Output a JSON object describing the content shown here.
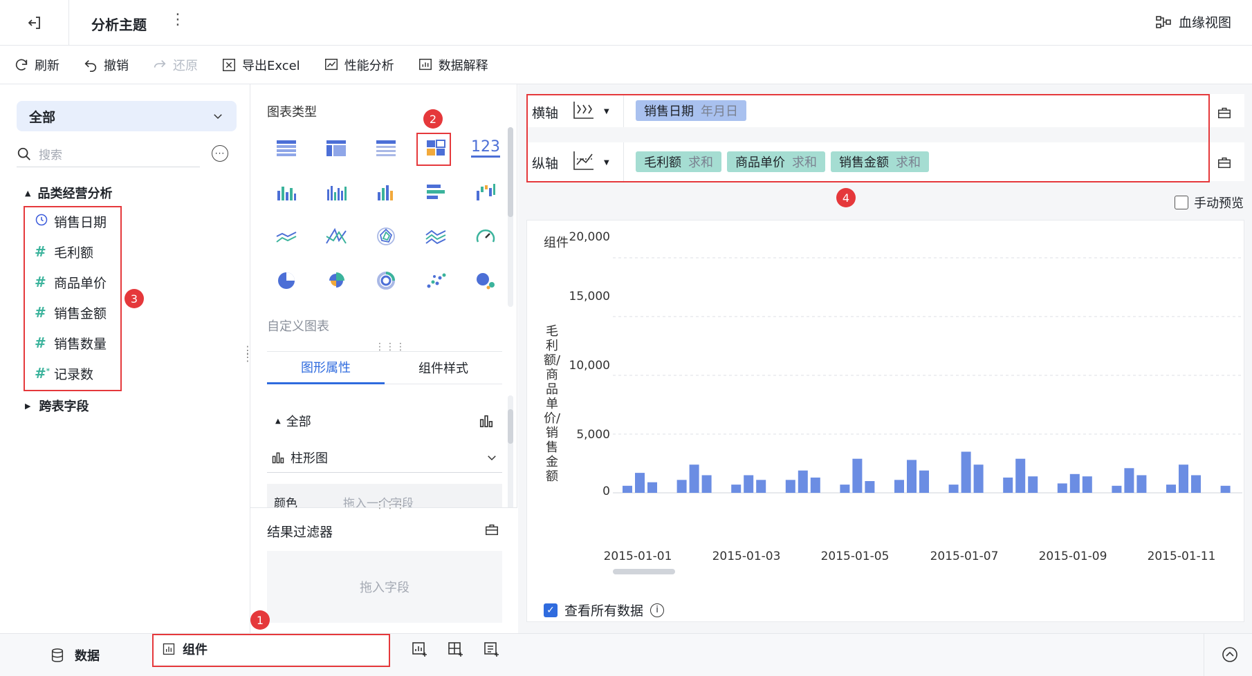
{
  "header": {
    "title": "分析主题",
    "lineage_label": "血缘视图"
  },
  "toolbar": {
    "refresh": "刷新",
    "undo": "撤销",
    "redo": "还原",
    "export_excel": "导出Excel",
    "performance": "性能分析",
    "data_explain": "数据解释"
  },
  "left": {
    "scope_select": "全部",
    "search_placeholder": "搜索",
    "group_title": "品类经营分析",
    "fields": [
      {
        "label": "销售日期",
        "kind": "date"
      },
      {
        "label": "毛利额",
        "kind": "measure"
      },
      {
        "label": "商品单价",
        "kind": "measure"
      },
      {
        "label": "销售金额",
        "kind": "measure"
      },
      {
        "label": "销售数量",
        "kind": "measure"
      },
      {
        "label": "记录数",
        "kind": "count"
      }
    ],
    "cross_table": "跨表字段"
  },
  "middle": {
    "chart_type_title": "图表类型",
    "number_icon_text": "123",
    "custom_chart": "自定义图表",
    "tabs": {
      "graph_props": "图形属性",
      "component_style": "组件样式"
    },
    "all_label": "全部",
    "chart_kind_select": "柱形图",
    "color_label": "颜色",
    "color_hint": "拖入一个字段",
    "filter_title": "结果过滤器",
    "filter_drop": "拖入字段"
  },
  "right": {
    "x_axis_label": "横轴",
    "y_axis_label": "纵轴",
    "x_fields": [
      {
        "name": "销售日期",
        "agg": "年月日"
      }
    ],
    "y_fields": [
      {
        "name": "毛利额",
        "agg": "求和"
      },
      {
        "name": "商品单价",
        "agg": "求和"
      },
      {
        "name": "销售金额",
        "agg": "求和"
      }
    ],
    "manual_preview": "手动预览",
    "component_title": "组件",
    "view_all_data": "查看所有数据"
  },
  "bottom": {
    "data_tab": "数据",
    "component_tab": "组件"
  },
  "annotations": [
    "1",
    "2",
    "3",
    "4"
  ],
  "colors": {
    "accent": "#2f6bde",
    "red": "#e5383b",
    "bar": "#6b8de3",
    "field_green": "#3bb39c"
  },
  "chart_data": {
    "type": "bar",
    "ylabel": "毛利额/商品单价/销售金额",
    "ylim": [
      0,
      20000
    ],
    "y_ticks": [
      "0",
      "5,000",
      "10,000",
      "15,000",
      "20,000"
    ],
    "x_tick_labels": [
      "2015-01-01",
      "2015-01-03",
      "2015-01-05",
      "2015-01-07",
      "2015-01-09",
      "2015-01-11"
    ],
    "categories": [
      "2015-01-01",
      "2015-01-02",
      "2015-01-03",
      "2015-01-04",
      "2015-01-05",
      "2015-01-06",
      "2015-01-07",
      "2015-01-08",
      "2015-01-09",
      "2015-01-10",
      "2015-01-11",
      "2015-01-12"
    ],
    "series": [
      {
        "values": [
          600,
          1100,
          700,
          1100,
          700,
          1100,
          700,
          1300,
          800,
          600,
          700,
          600
        ]
      },
      {
        "values": [
          1700,
          2400,
          1500,
          1900,
          2900,
          2800,
          3500,
          2900,
          1600,
          2100,
          2400,
          1300
        ]
      },
      {
        "values": [
          900,
          1500,
          1100,
          1300,
          1000,
          1900,
          2400,
          1400,
          1400,
          1500,
          1500,
          900
        ]
      }
    ]
  }
}
